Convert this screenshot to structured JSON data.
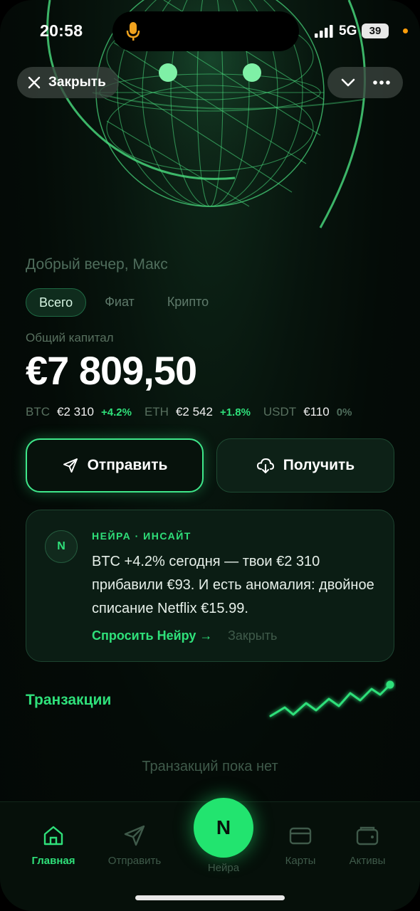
{
  "status": {
    "time": "20:58",
    "network": "5G",
    "battery": "39"
  },
  "header": {
    "close_label": "Закрыть"
  },
  "greeting": "Добрый вечер, Макс",
  "tabs": [
    {
      "label": "Всего",
      "active": true
    },
    {
      "label": "Фиат",
      "active": false
    },
    {
      "label": "Крипто",
      "active": false
    }
  ],
  "capital": {
    "label": "Общий капитал",
    "value": "€7 809,50"
  },
  "holdings": [
    {
      "ticker": "BTC",
      "value": "€2 310",
      "change": "+4.2%"
    },
    {
      "ticker": "ETH",
      "value": "€2 542",
      "change": "+1.8%"
    },
    {
      "ticker": "USDT",
      "value": "€110",
      "change": "0%"
    }
  ],
  "actions": {
    "send_label": "Отправить",
    "receive_label": "Получить"
  },
  "insight": {
    "badge": "N",
    "tag": "НЕЙРА · ИНСАЙТ",
    "body": "BTC +4.2% сегодня — твои €2 310 прибавили €93. И есть аномалия: двойное списание Netflix €15.99.",
    "ask_label": "Спросить Нейру →",
    "close_label": "Закрыть"
  },
  "transactions": {
    "title": "Транзакции",
    "empty_text": "Транзакций пока нет"
  },
  "nav": {
    "home": "Главная",
    "send": "Отправить",
    "center_letter": "N",
    "center_label": "Нейра",
    "cards": "Карты",
    "assets": "Активы"
  },
  "colors": {
    "accent": "#2fe07a",
    "background": "#040b07",
    "muted": "#3f5a4a"
  }
}
